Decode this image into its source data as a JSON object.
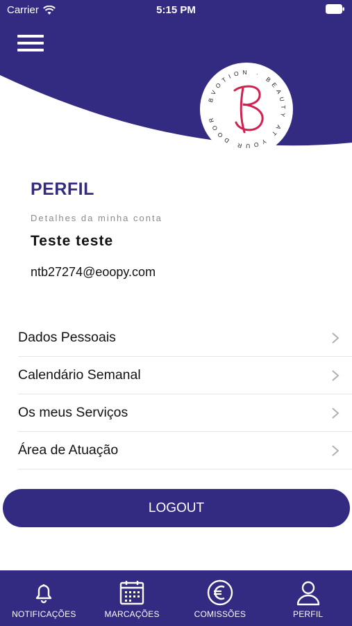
{
  "status_bar": {
    "carrier": "Carrier",
    "time": "5:15 PM"
  },
  "header": {
    "menu_icon": "hamburger-menu-icon",
    "logo_icon": "bvotion-logo",
    "logo_text": "BVOTION · BEAUTY AT YOUR DOOR",
    "brand_color": "#332b82"
  },
  "profile": {
    "title": "PERFIL",
    "subtitle": "Detalhes da minha conta",
    "name": "Teste teste",
    "email": "ntb27274@eoopy.com"
  },
  "menu": {
    "items": [
      {
        "label": "Dados Pessoais"
      },
      {
        "label": "Calendário Semanal"
      },
      {
        "label": "Os meus Serviços"
      },
      {
        "label": "Área de Atuação"
      }
    ]
  },
  "logout_label": "LOGOUT",
  "tabs": [
    {
      "label": "NOTIFICAÇÕES",
      "icon": "bell-icon"
    },
    {
      "label": "MARCAÇÕES",
      "icon": "calendar-icon"
    },
    {
      "label": "COMISSÕES",
      "icon": "euro-icon"
    },
    {
      "label": "PERFIL",
      "icon": "user-icon"
    }
  ]
}
